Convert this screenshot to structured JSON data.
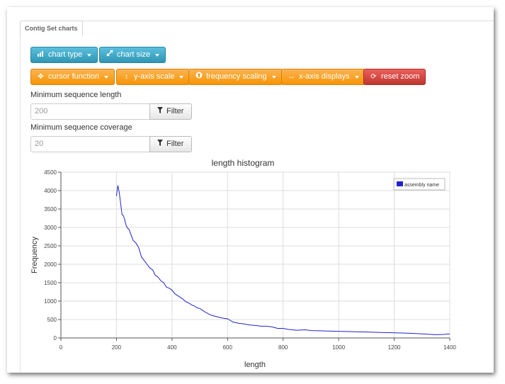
{
  "tabs": [
    {
      "label": "Contig Set charts",
      "active": true
    }
  ],
  "toolbar_row1": [
    {
      "label": "chart type",
      "icon": "bar-chart-icon",
      "style": "info"
    },
    {
      "label": "chart size",
      "icon": "resize-icon",
      "style": "info"
    }
  ],
  "toolbar_row2": [
    {
      "label": "cursor function",
      "icon": "move-icon",
      "style": "warning"
    },
    {
      "label": "y-axis scale",
      "icon": "vertical-arrows-icon",
      "style": "warning"
    },
    {
      "label": "frequency scaling",
      "icon": "circle-arrow-icon",
      "style": "warning"
    },
    {
      "label": "x-axis displays",
      "icon": "horizontal-arrows-icon",
      "style": "warning"
    },
    {
      "label": "reset zoom",
      "icon": "refresh-icon",
      "style": "danger"
    }
  ],
  "filters": {
    "min_length": {
      "label": "Minimum sequence length",
      "placeholder": "200",
      "button": "Filter"
    },
    "min_coverage": {
      "label": "Minimum sequence coverage",
      "placeholder": "20",
      "button": "Filter"
    }
  },
  "colors": {
    "series": "#2222cc",
    "grid": "#dddddd",
    "axis": "#555555"
  },
  "chart_data": {
    "type": "line",
    "title": "length histogram",
    "xlabel": "length",
    "ylabel": "Frequency",
    "xlim": [
      0,
      1400
    ],
    "ylim": [
      0,
      4500
    ],
    "xticks": [
      0,
      200,
      400,
      600,
      800,
      1000,
      1200,
      1400
    ],
    "yticks": [
      0,
      500,
      1000,
      1500,
      2000,
      2500,
      3000,
      3500,
      4000,
      4500
    ],
    "grid": true,
    "legend_position": "top-right",
    "series": [
      {
        "name": "assembly name",
        "x": [
          200,
          205,
          210,
          215,
          220,
          225,
          230,
          235,
          240,
          245,
          250,
          260,
          270,
          280,
          290,
          300,
          310,
          320,
          330,
          340,
          350,
          360,
          370,
          380,
          390,
          400,
          410,
          420,
          430,
          440,
          450,
          460,
          470,
          480,
          490,
          500,
          520,
          540,
          560,
          580,
          600,
          620,
          640,
          660,
          680,
          700,
          720,
          740,
          760,
          780,
          800,
          820,
          850,
          880,
          900,
          950,
          1000,
          1050,
          1100,
          1150,
          1200,
          1250,
          1300,
          1350,
          1380,
          1400
        ],
        "y": [
          3850,
          4140,
          3950,
          3650,
          3350,
          3320,
          3200,
          3050,
          2980,
          2950,
          2850,
          2650,
          2580,
          2450,
          2200,
          2100,
          2000,
          1900,
          1850,
          1700,
          1650,
          1550,
          1500,
          1380,
          1350,
          1300,
          1200,
          1150,
          1100,
          1050,
          980,
          950,
          900,
          870,
          820,
          800,
          700,
          620,
          580,
          540,
          520,
          430,
          400,
          380,
          350,
          340,
          320,
          320,
          300,
          260,
          260,
          230,
          210,
          220,
          200,
          190,
          180,
          170,
          160,
          150,
          140,
          130,
          110,
          90,
          95,
          110
        ]
      }
    ]
  }
}
